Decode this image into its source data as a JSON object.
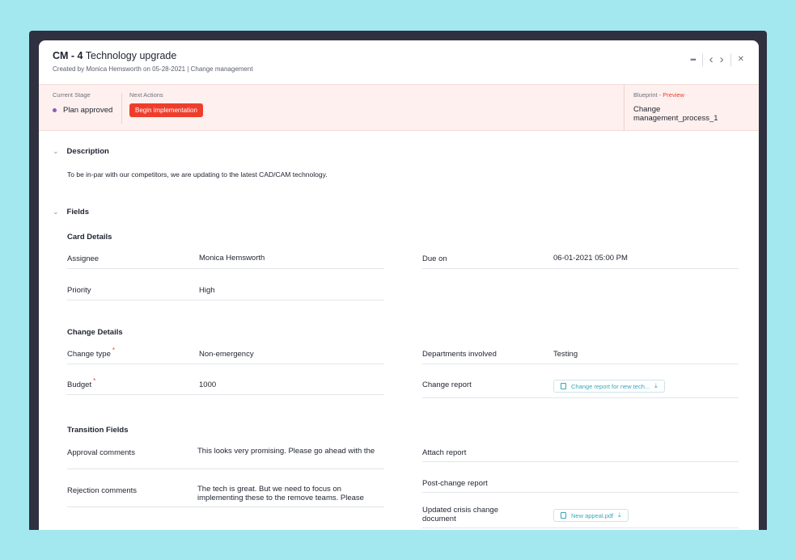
{
  "header": {
    "card_id": "CM - 4",
    "card_title": "Technology upgrade",
    "subtitle": "Created by Monica Hemsworth on 05-28-2021 | Change management",
    "more_icon": "•••",
    "prev_icon": "‹",
    "next_icon": "›",
    "close_icon": "✕"
  },
  "stage": {
    "current_label": "Current Stage",
    "current_value": "Plan approved",
    "next_label": "Next Actions",
    "next_button": "Begin implementation",
    "blueprint_label": "Blueprint",
    "blueprint_preview": "- Preview",
    "blueprint_value": "Change management_process_1"
  },
  "description": {
    "heading": "Description",
    "text": "To be in-par with our competitors, we are updating to the latest CAD/CAM technology."
  },
  "fields": {
    "heading": "Fields",
    "card_details": {
      "title": "Card Details",
      "assignee_label": "Assignee",
      "assignee_value": "Monica Hemsworth",
      "due_label": "Due on",
      "due_value": "06-01-2021 05:00 PM",
      "priority_label": "Priority",
      "priority_value": "High"
    },
    "change_details": {
      "title": "Change Details",
      "type_label": "Change type",
      "type_value": "Non-emergency",
      "dept_label": "Departments involved",
      "dept_value": "Testing",
      "budget_label": "Budget",
      "budget_value": "1000",
      "report_label": "Change report",
      "report_file": "Change report for new tech..."
    },
    "transition": {
      "title": "Transition Fields",
      "approval_label": "Approval comments",
      "approval_value": "This looks very promising. Please go ahead with the",
      "attach_label": "Attach report",
      "rejection_label": "Rejection comments",
      "rejection_value": "The tech is great. But we need to focus on implementing these to the remove teams. Please",
      "post_label": "Post-change report",
      "crisis_label": "Updated crisis change document",
      "crisis_file": "New appeal.pdf"
    },
    "required_mark": "*"
  },
  "colors": {
    "background": "#a3e8ee",
    "accent_red": "#ef3d2c",
    "stage_bg": "#fdf0ee",
    "link_teal": "#3aa6b9",
    "stage_dot": "#8a5cc2"
  },
  "icons": {
    "collapse": "chevron-down-icon",
    "file": "document-icon",
    "download": "download-icon"
  }
}
